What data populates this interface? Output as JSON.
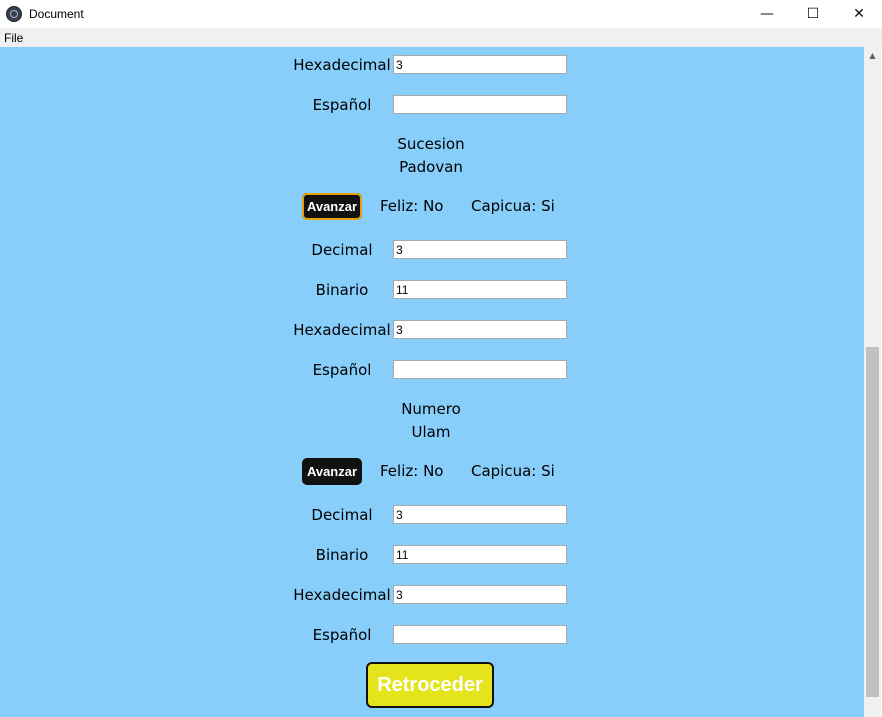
{
  "window": {
    "title": "Document",
    "minimize_glyph": "—",
    "maximize_glyph": "☐",
    "close_glyph": "✕"
  },
  "menu": {
    "items": [
      {
        "label": "File"
      }
    ]
  },
  "sections": [
    {
      "fields": [
        {
          "label": "Hexadecimal",
          "value": "3"
        },
        {
          "label": "Español",
          "value": ""
        }
      ]
    },
    {
      "heading_line1": "Sucesion",
      "heading_line2": "Padovan",
      "button_label": "Avanzar",
      "feliz": "Feliz: No",
      "capicua": "Capicua: Si",
      "fields": [
        {
          "label": "Decimal",
          "value": "3"
        },
        {
          "label": "Binario",
          "value": "11"
        },
        {
          "label": "Hexadecimal",
          "value": "3"
        },
        {
          "label": "Español",
          "value": ""
        }
      ]
    },
    {
      "heading_line1": "Numero",
      "heading_line2": "Ulam",
      "button_label": "Avanzar",
      "feliz": "Feliz: No",
      "capicua": "Capicua: Si",
      "fields": [
        {
          "label": "Decimal",
          "value": "3"
        },
        {
          "label": "Binario",
          "value": "11"
        },
        {
          "label": "Hexadecimal",
          "value": "3"
        },
        {
          "label": "Español",
          "value": ""
        }
      ]
    }
  ],
  "back_button": {
    "label": "Retroceder"
  },
  "colors": {
    "background": "#87cefa",
    "button_dark": "#111111",
    "back_button": "#e5e31a",
    "focus_ring": "#e5a20a"
  }
}
